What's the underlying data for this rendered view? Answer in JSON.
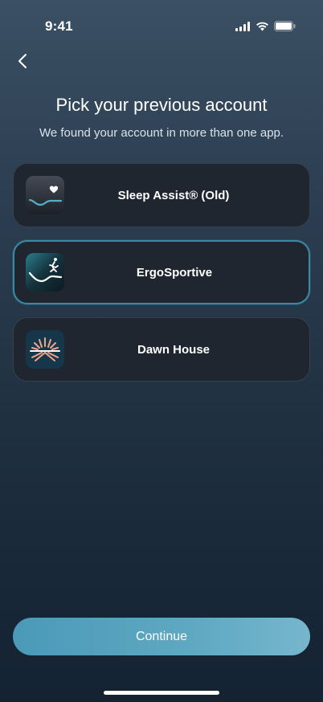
{
  "status_bar": {
    "time": "9:41",
    "icons": [
      "signal-icon",
      "wifi-icon",
      "battery-icon"
    ]
  },
  "header": {
    "back_icon": "chevron-left-icon",
    "title": "Pick your previous account",
    "subtitle": "We found your account in more than one app."
  },
  "accounts": [
    {
      "label": "Sleep Assist® (Old)",
      "icon": "sleep-assist-app-icon",
      "selected": false
    },
    {
      "label": "ErgoSportive",
      "icon": "ergosportive-app-icon",
      "selected": true
    },
    {
      "label": "Dawn House",
      "icon": "dawn-house-app-icon",
      "selected": false
    }
  ],
  "footer": {
    "continue_label": "Continue"
  },
  "colors": {
    "accent": "#3b8aa5",
    "button": "#5fa8c2",
    "card": "#1f2630"
  }
}
